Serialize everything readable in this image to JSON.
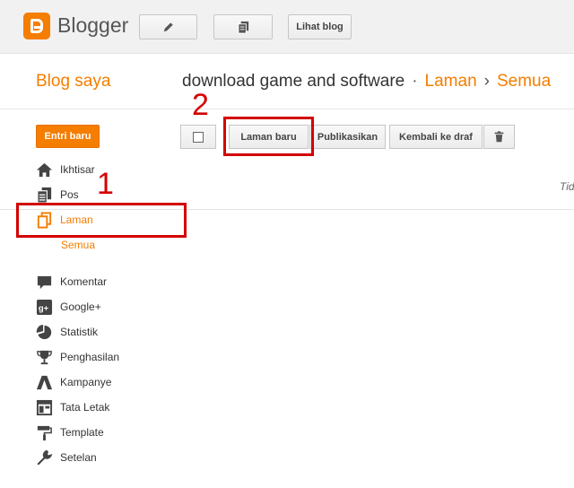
{
  "header": {
    "brand": "Blogger",
    "view_blog_label": "Lihat blog"
  },
  "section": {
    "my_blogs": "Blog saya",
    "blog_name": "download game and software",
    "separator_dot": "·",
    "crumb_pages": "Laman",
    "separator_arrow": "›",
    "crumb_all": "Semua"
  },
  "sidebar": {
    "new_post": "Entri baru",
    "items": [
      {
        "label": "Ikhtisar",
        "icon": "home-icon"
      },
      {
        "label": "Pos",
        "icon": "posts-icon"
      },
      {
        "label": "Laman",
        "icon": "pages-icon",
        "active": true
      },
      {
        "label": "Komentar",
        "icon": "comment-icon"
      },
      {
        "label": "Google+",
        "icon": "google-plus-icon"
      },
      {
        "label": "Statistik",
        "icon": "pie-chart-icon"
      },
      {
        "label": "Penghasilan",
        "icon": "trophy-icon"
      },
      {
        "label": "Kampanye",
        "icon": "adwords-icon"
      },
      {
        "label": "Tata Letak",
        "icon": "layout-icon"
      },
      {
        "label": "Template",
        "icon": "paint-roller-icon"
      },
      {
        "label": "Setelan",
        "icon": "wrench-icon"
      }
    ],
    "sub_all": "Semua"
  },
  "toolbar": {
    "new_page": "Laman baru",
    "publish": "Publikasikan",
    "revert_draft": "Kembali ke draf"
  },
  "content": {
    "cut_text": "Tid"
  },
  "annotations": {
    "marker_1": "1",
    "marker_2": "2"
  },
  "colors": {
    "accent": "#f57d00",
    "annotation": "#d40000"
  }
}
